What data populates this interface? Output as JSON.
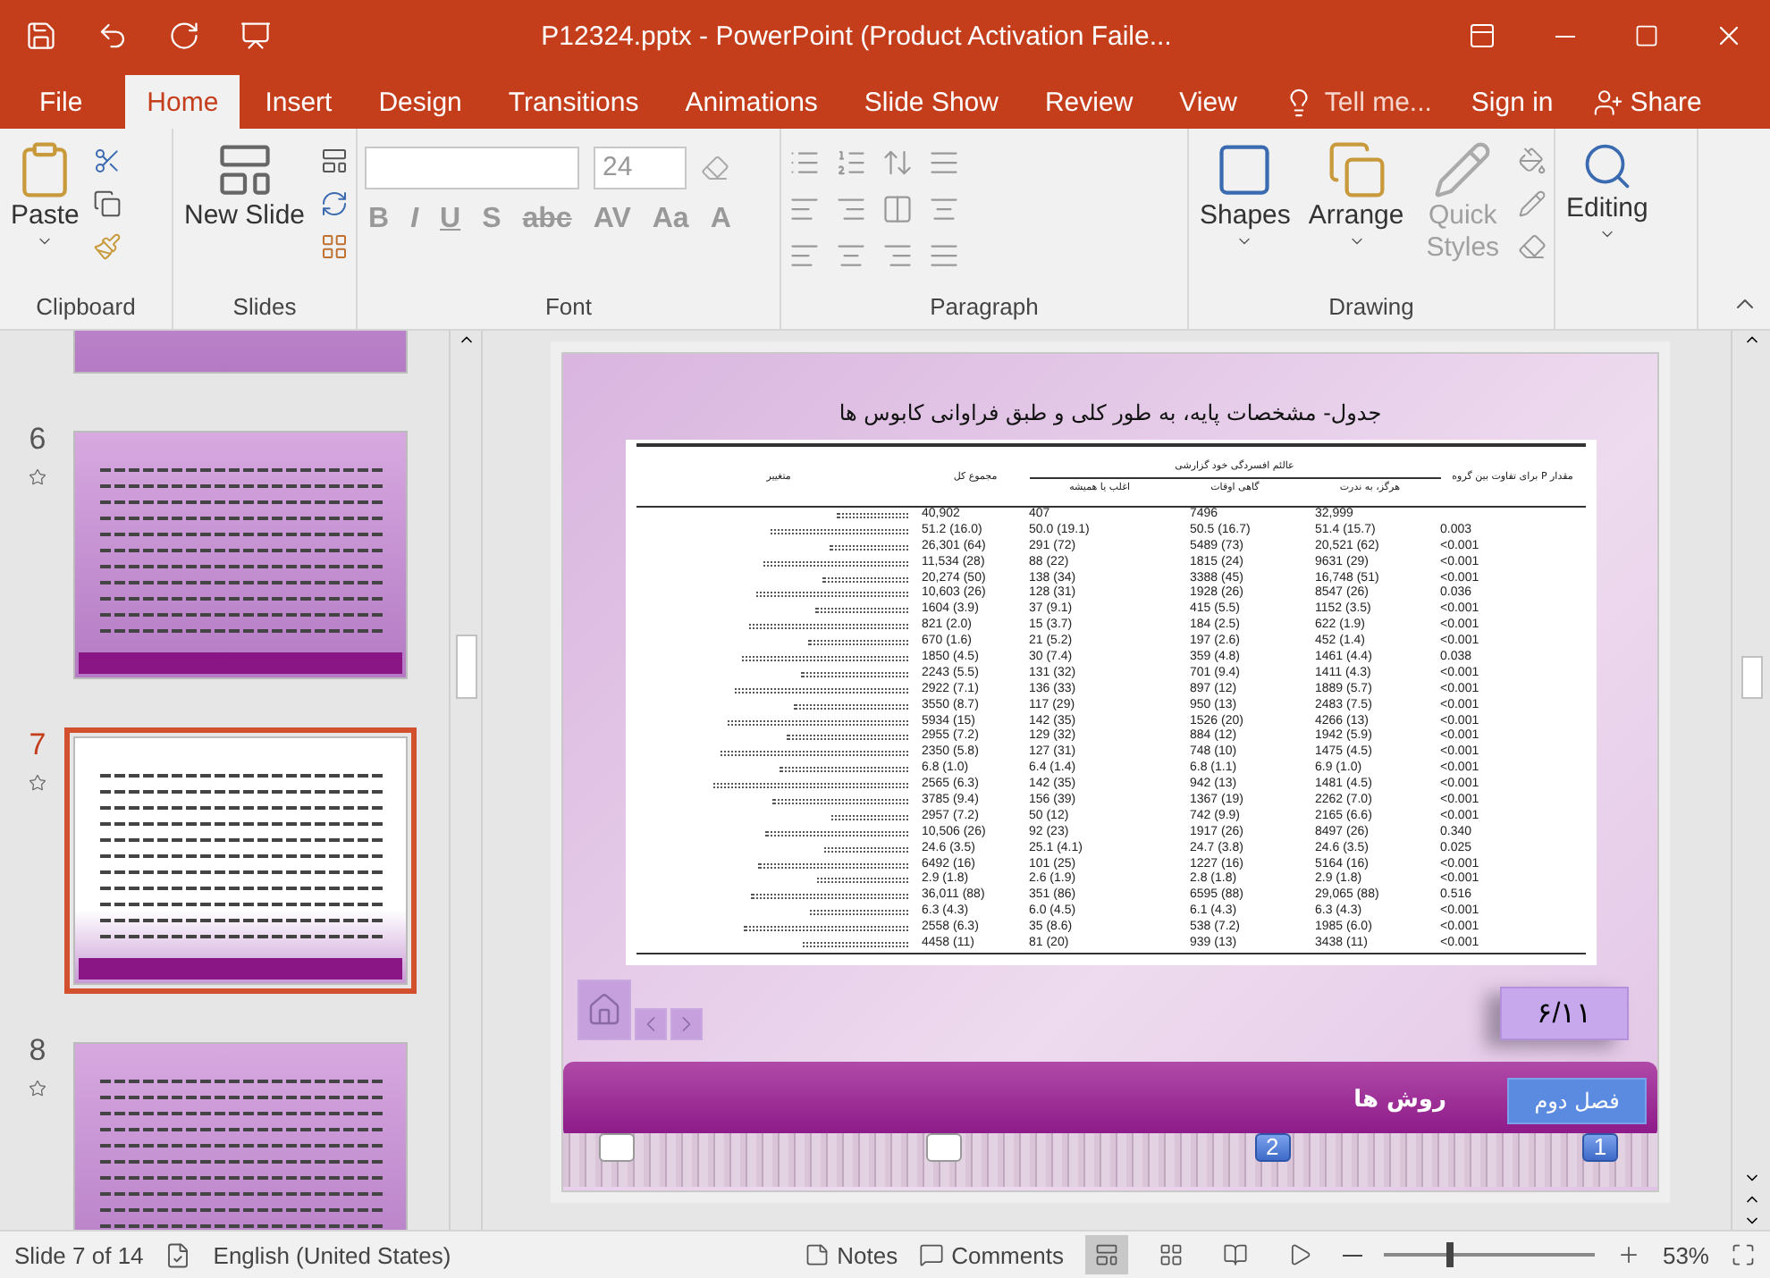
{
  "window": {
    "title": "P12324.pptx - PowerPoint (Product Activation Faile..."
  },
  "menu_tabs": [
    {
      "label": "File",
      "selected": false
    },
    {
      "label": "Home",
      "selected": true
    },
    {
      "label": "Insert",
      "selected": false
    },
    {
      "label": "Design",
      "selected": false
    },
    {
      "label": "Transitions",
      "selected": false
    },
    {
      "label": "Animations",
      "selected": false
    },
    {
      "label": "Slide Show",
      "selected": false
    },
    {
      "label": "Review",
      "selected": false
    },
    {
      "label": "View",
      "selected": false
    }
  ],
  "tell_me": {
    "placeholder": "Tell me..."
  },
  "sign_in": "Sign in",
  "share": "Share",
  "ribbon": {
    "paste": "Paste",
    "new_slide": "New Slide",
    "font_size": "24",
    "font_buttons": [
      "B",
      "I",
      "U",
      "S",
      "abc",
      "AV",
      "Aa",
      "A"
    ],
    "shapes": "Shapes",
    "arrange": "Arrange",
    "quick_styles": {
      "label": "Quick Styles",
      "disabled": true
    },
    "editing": "Editing",
    "groups": [
      "Clipboard",
      "Slides",
      "Font",
      "Paragraph",
      "Drawing"
    ]
  },
  "thumbnails": [
    {
      "number": "6",
      "selected": false
    },
    {
      "number": "7",
      "selected": true
    },
    {
      "number": "8",
      "selected": false
    }
  ],
  "slide": {
    "title": "جدول- مشخصات پایه، به طور کلی و طبق فراوانی کابوس ها",
    "table": {
      "variable_header": "متغییر",
      "total_header": "مجموع کل",
      "group_header": "عالئم افسردگی خود گزارشی",
      "p_header": "مقدار P برای تفاوت بین گروه",
      "subheaders": [
        "هرگز، به ندرت",
        "گاهی اوقات",
        "اغلب یا همیشه"
      ],
      "rows": [
        [
          "40,902",
          "407",
          "7496",
          "32,999"
        ],
        [
          "51.2 (16.0)",
          "50.0 (19.1)",
          "50.5 (16.7)",
          "51.4 (15.7)",
          "0.003"
        ],
        [
          "26,301 (64)",
          "291 (72)",
          "5489 (73)",
          "20,521 (62)",
          "<0.001"
        ],
        [
          "11,534 (28)",
          "88 (22)",
          "1815 (24)",
          "9631 (29)",
          "<0.001"
        ],
        [
          "20,274 (50)",
          "138 (34)",
          "3388 (45)",
          "16,748 (51)",
          "<0.001"
        ],
        [
          "10,603 (26)",
          "128 (31)",
          "1928 (26)",
          "8547 (26)",
          "0.036"
        ],
        [
          "1604 (3.9)",
          "37 (9.1)",
          "415 (5.5)",
          "1152 (3.5)",
          "<0.001"
        ],
        [
          "821 (2.0)",
          "15 (3.7)",
          "184 (2.5)",
          "622 (1.9)",
          "<0.001"
        ],
        [
          "670 (1.6)",
          "21 (5.2)",
          "197 (2.6)",
          "452 (1.4)",
          "<0.001"
        ],
        [
          "1850 (4.5)",
          "30 (7.4)",
          "359 (4.8)",
          "1461 (4.4)",
          "0.038"
        ],
        [
          "2243 (5.5)",
          "131 (32)",
          "701 (9.4)",
          "1411 (4.3)",
          "<0.001"
        ],
        [
          "2922 (7.1)",
          "136 (33)",
          "897 (12)",
          "1889 (5.7)",
          "<0.001"
        ],
        [
          "3550 (8.7)",
          "117 (29)",
          "950 (13)",
          "2483 (7.5)",
          "<0.001"
        ],
        [
          "5934 (15)",
          "142 (35)",
          "1526 (20)",
          "4266 (13)",
          "<0.001"
        ],
        [
          "2955 (7.2)",
          "129 (32)",
          "884 (12)",
          "1942 (5.9)",
          "<0.001"
        ],
        [
          "2350 (5.8)",
          "127 (31)",
          "748 (10)",
          "1475 (4.5)",
          "<0.001"
        ],
        [
          "6.8 (1.0)",
          "6.4 (1.4)",
          "6.8 (1.1)",
          "6.9 (1.0)",
          "<0.001"
        ],
        [
          "2565 (6.3)",
          "142 (35)",
          "942 (13)",
          "1481 (4.5)",
          "<0.001"
        ],
        [
          "3785 (9.4)",
          "156 (39)",
          "1367 (19)",
          "2262 (7.0)",
          "<0.001"
        ],
        [
          "2957 (7.2)",
          "50 (12)",
          "742 (9.9)",
          "2165 (6.6)",
          "<0.001"
        ],
        [
          "10,506 (26)",
          "92 (23)",
          "1917 (26)",
          "8497 (26)",
          "0.340"
        ],
        [
          "24.6 (3.5)",
          "25.1 (4.1)",
          "24.7 (3.8)",
          "24.6 (3.5)",
          "0.025"
        ],
        [
          "6492 (16)",
          "101 (25)",
          "1227 (16)",
          "5164 (16)",
          "<0.001"
        ],
        [
          "2.9 (1.8)",
          "2.6 (1.9)",
          "2.8 (1.8)",
          "2.9 (1.8)",
          "<0.001"
        ],
        [
          "36,011 (88)",
          "351 (86)",
          "6595 (88)",
          "29,065 (88)",
          "0.516"
        ],
        [
          "6.3 (4.3)",
          "6.0 (4.5)",
          "6.1 (4.3)",
          "6.3 (4.3)",
          "<0.001"
        ],
        [
          "2558 (6.3)",
          "35 (8.6)",
          "538 (7.2)",
          "1985 (6.0)",
          "<0.001"
        ],
        [
          "4458 (11)",
          "81 (20)",
          "939 (13)",
          "3438 (11)",
          "<0.001"
        ]
      ]
    },
    "page_number": "۶/۱۱",
    "section_button": "فصل دوم",
    "section_title": "روش ها",
    "markers": [
      {
        "kind": "blank"
      },
      {
        "kind": "blank"
      },
      {
        "kind": "numbered",
        "label": "2"
      },
      {
        "kind": "numbered",
        "label": "1"
      }
    ]
  },
  "status_bar": {
    "slide": "Slide 7 of 14",
    "language": "English (United States)",
    "notes": "Notes",
    "comments": "Comments",
    "zoom": "53%",
    "zoom_slider": {
      "level": 0.3
    }
  }
}
